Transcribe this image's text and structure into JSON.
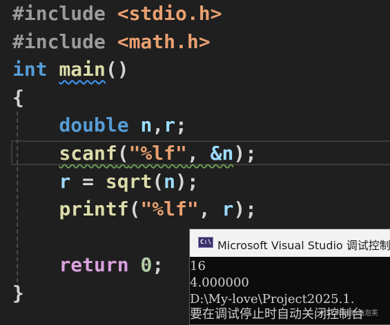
{
  "editor": {
    "lines": [
      {
        "tokens": [
          {
            "t": "#include",
            "c": "kw-pp"
          },
          {
            "t": " ",
            "c": "punct"
          },
          {
            "t": "<stdio.h>",
            "c": "kw-str"
          }
        ]
      },
      {
        "tokens": [
          {
            "t": "#include",
            "c": "kw-pp"
          },
          {
            "t": " ",
            "c": "punct"
          },
          {
            "t": "<math.h>",
            "c": "kw-str"
          }
        ]
      },
      {
        "tokens": [
          {
            "t": "int",
            "c": "kw-type"
          },
          {
            "t": " ",
            "c": "punct"
          },
          {
            "t": "main",
            "c": "fn squiggle-blue"
          },
          {
            "t": "()",
            "c": "punct"
          }
        ]
      },
      {
        "tokens": [
          {
            "t": "{",
            "c": "punct"
          }
        ]
      },
      {
        "tokens": [
          {
            "t": "    ",
            "c": "punct"
          },
          {
            "t": "double",
            "c": "kw-type"
          },
          {
            "t": " ",
            "c": "punct"
          },
          {
            "t": "n",
            "c": "var"
          },
          {
            "t": ",",
            "c": "punct"
          },
          {
            "t": "r",
            "c": "var"
          },
          {
            "t": ";",
            "c": "punct"
          }
        ]
      },
      {
        "tokens": [
          {
            "t": "    ",
            "c": "punct"
          },
          {
            "t": "scanf",
            "c": "fn squiggle-green"
          },
          {
            "t": "(",
            "c": "punct squiggle-green"
          },
          {
            "t": "\"%lf\"",
            "c": "kw-str squiggle-green"
          },
          {
            "t": ", ",
            "c": "punct squiggle-green"
          },
          {
            "t": "&n",
            "c": "var squiggle-green"
          },
          {
            "t": ");",
            "c": "punct"
          }
        ]
      },
      {
        "tokens": [
          {
            "t": "    ",
            "c": "punct"
          },
          {
            "t": "r",
            "c": "var"
          },
          {
            "t": " = ",
            "c": "punct"
          },
          {
            "t": "sqrt",
            "c": "fn"
          },
          {
            "t": "(",
            "c": "punct"
          },
          {
            "t": "n",
            "c": "var"
          },
          {
            "t": ");",
            "c": "punct"
          }
        ]
      },
      {
        "tokens": [
          {
            "t": "    ",
            "c": "punct"
          },
          {
            "t": "printf",
            "c": "fn"
          },
          {
            "t": "(",
            "c": "punct"
          },
          {
            "t": "\"%lf\"",
            "c": "kw-str"
          },
          {
            "t": ", ",
            "c": "punct"
          },
          {
            "t": "r",
            "c": "var"
          },
          {
            "t": ");",
            "c": "punct"
          }
        ]
      },
      {
        "tokens": []
      },
      {
        "tokens": [
          {
            "t": "    ",
            "c": "punct"
          },
          {
            "t": "return",
            "c": "ctrl"
          },
          {
            "t": " ",
            "c": "punct"
          },
          {
            "t": "0",
            "c": "num"
          },
          {
            "t": ";",
            "c": "punct"
          }
        ]
      },
      {
        "tokens": [
          {
            "t": "}",
            "c": "punct"
          }
        ]
      }
    ]
  },
  "console": {
    "title": "Microsoft Visual Studio 调试控制台",
    "icon_label": "C:\\",
    "output": [
      "16",
      "4.000000",
      "D:\\My-love\\Project2025.1.",
      "要在调试停止时自动关闭控制台"
    ]
  },
  "watermark": "CSDN @奶油泡芙"
}
